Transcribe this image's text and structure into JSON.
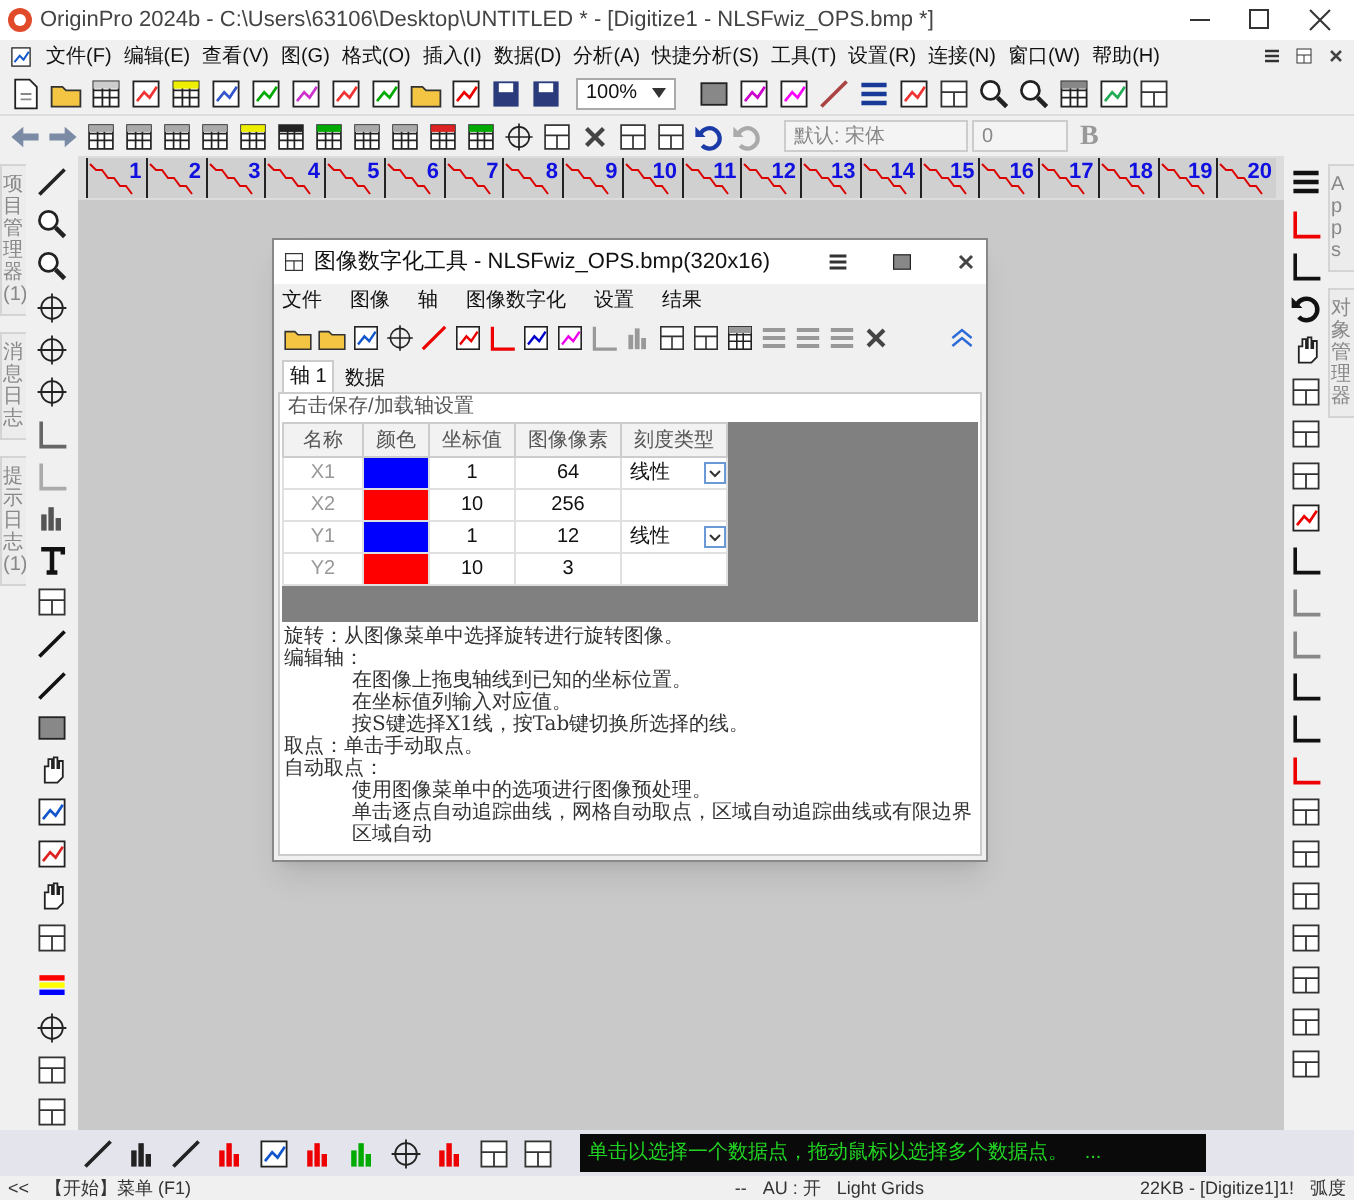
{
  "window": {
    "title": "OriginPro 2024b - C:\\Users\\63106\\Desktop\\UNTITLED * - [Digitize1 - NLSFwiz_OPS.bmp *]"
  },
  "menu": [
    "文件(F)",
    "编辑(E)",
    "查看(V)",
    "图(G)",
    "格式(O)",
    "插入(I)",
    "数据(D)",
    "分析(A)",
    "快捷分析(S)",
    "工具(T)",
    "设置(R)",
    "连接(N)",
    "窗口(W)",
    "帮助(H)"
  ],
  "toolbar": {
    "zoom": "100%",
    "font": "默认: 宋体",
    "font_size": "0",
    "bold": "B"
  },
  "page_tabs": [
    "1",
    "2",
    "3",
    "4",
    "5",
    "6",
    "7",
    "8",
    "9",
    "10",
    "11",
    "12",
    "13",
    "14",
    "15",
    "16",
    "17",
    "18",
    "19",
    "20"
  ],
  "left_dock_tabs": [
    "项目管理器 (1)",
    "消息日志",
    "提示日志 (1)"
  ],
  "right_dock_tabs": [
    "Apps",
    "对象管理器"
  ],
  "dialog": {
    "title": "图像数字化工具 - NLSFwiz_OPS.bmp(320x16)",
    "menu": [
      "文件",
      "图像",
      "轴",
      "图像数字化",
      "设置",
      "结果"
    ],
    "tabs": [
      {
        "label": "轴 1",
        "selected": true
      },
      {
        "label": "数据",
        "selected": false
      }
    ],
    "hint": "右击保存/加载轴设置",
    "table": {
      "columns": [
        "名称",
        "颜色",
        "坐标值",
        "图像像素",
        "刻度类型"
      ],
      "rows": [
        {
          "name": "X1",
          "color": "#0000ff",
          "value": "1",
          "pixel": "64",
          "scale": "线性"
        },
        {
          "name": "X2",
          "color": "#ff0000",
          "value": "10",
          "pixel": "256"
        },
        {
          "name": "Y1",
          "color": "#0000ff",
          "value": "1",
          "pixel": "12",
          "scale": "线性"
        },
        {
          "name": "Y2",
          "color": "#ff0000",
          "value": "10",
          "pixel": "3"
        }
      ]
    },
    "help": [
      {
        "kind": "heading",
        "text": "旋转：从图像菜单中选择旋转进行旋转图像。"
      },
      {
        "kind": "heading",
        "text": "编辑轴："
      },
      {
        "kind": "indented",
        "text": "在图像上拖曳轴线到已知的坐标位置。"
      },
      {
        "kind": "indented",
        "text": "在坐标值列输入对应值。"
      },
      {
        "kind": "indented",
        "text": "按S键选择X1线，按Tab键切换所选择的线。"
      },
      {
        "kind": "heading",
        "text": "取点：单击手动取点。"
      },
      {
        "kind": "heading",
        "text": "自动取点："
      },
      {
        "kind": "indented",
        "text": "使用图像菜单中的选项进行图像预处理。"
      },
      {
        "kind": "indented",
        "text": "单击逐点自动追踪曲线，网格自动取点，区域自动追踪曲线或有限边界区域自动"
      }
    ]
  },
  "message": "单击以选择一个数据点，拖动鼠标以选择多个数据点。   ...",
  "status_bar": [
    "<<",
    "【开始】菜单 (F1)",
    "--",
    "AU : 开",
    "Light Grids",
    "22KB - [Digitize1]1!",
    "弧度"
  ]
}
